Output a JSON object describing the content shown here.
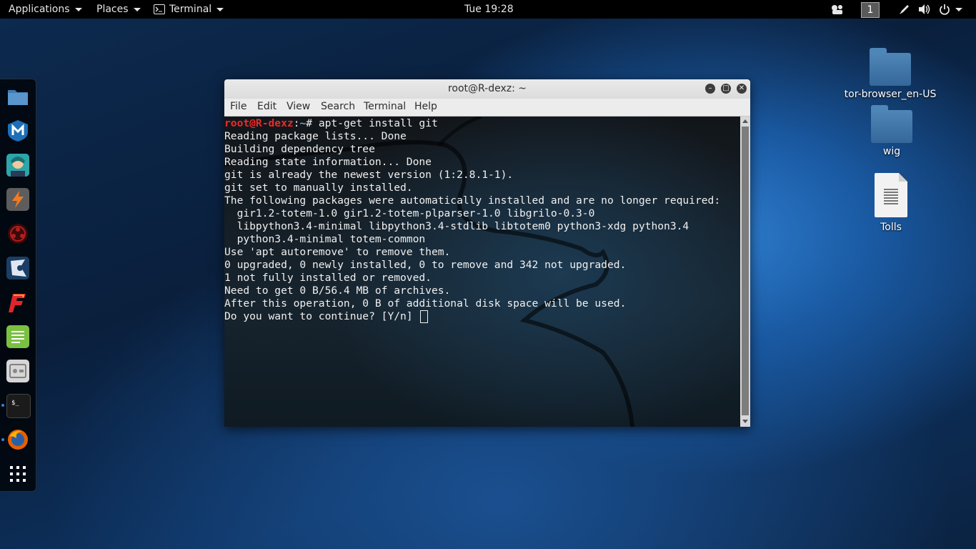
{
  "topbar": {
    "applications_label": "Applications",
    "places_label": "Places",
    "terminal_label": "Terminal",
    "clock": "Tue 19:28",
    "workspace": "1"
  },
  "dock": {
    "items": [
      {
        "name": "files",
        "icon": "folder-icon"
      },
      {
        "name": "metasploit",
        "icon": "metasploit-icon"
      },
      {
        "name": "armitage",
        "icon": "armitage-icon"
      },
      {
        "name": "burpsuite",
        "icon": "burpsuite-icon"
      },
      {
        "name": "beef",
        "icon": "beef-icon"
      },
      {
        "name": "maltego",
        "icon": "maltego-icon"
      },
      {
        "name": "faraday",
        "icon": "faraday-icon"
      },
      {
        "name": "leafpad",
        "icon": "text-editor-icon"
      },
      {
        "name": "cutycapt",
        "icon": "screenshot-tool-icon"
      },
      {
        "name": "terminal",
        "icon": "terminal-icon"
      },
      {
        "name": "firefox",
        "icon": "firefox-icon"
      },
      {
        "name": "show-apps",
        "icon": "grid-icon"
      }
    ]
  },
  "desktop": {
    "icons": [
      {
        "label": "tor-browser_en-US",
        "icon": "folder-icon"
      },
      {
        "label": "wig",
        "icon": "folder-icon"
      },
      {
        "label": "Tolls",
        "icon": "document-icon"
      }
    ]
  },
  "window": {
    "title": "root@R-dexz: ~",
    "menu": [
      "File",
      "Edit",
      "View",
      "Search",
      "Terminal",
      "Help"
    ]
  },
  "terminal": {
    "prompt_user": "root@R-dexz",
    "prompt_sep": ":",
    "prompt_path": "~",
    "prompt_end": "# ",
    "command": "apt-get install git",
    "output": [
      "Reading package lists... Done",
      "Building dependency tree",
      "Reading state information... Done",
      "git is already the newest version (1:2.8.1-1).",
      "git set to manually installed.",
      "The following packages were automatically installed and are no longer required:",
      "  gir1.2-totem-1.0 gir1.2-totem-plparser-1.0 libgrilo-0.3-0",
      "  libpython3.4-minimal libpython3.4-stdlib libtotem0 python3-xdg python3.4",
      "  python3.4-minimal totem-common",
      "Use 'apt autoremove' to remove them.",
      "0 upgraded, 0 newly installed, 0 to remove and 342 not upgraded.",
      "1 not fully installed or removed.",
      "Need to get 0 B/56.4 MB of archives.",
      "After this operation, 0 B of additional disk space will be used."
    ],
    "question": "Do you want to continue? [Y/n] "
  },
  "colors": {
    "prompt_user": "#ef2929",
    "prompt_path": "#729fcf",
    "accent": "#3b82d6"
  }
}
